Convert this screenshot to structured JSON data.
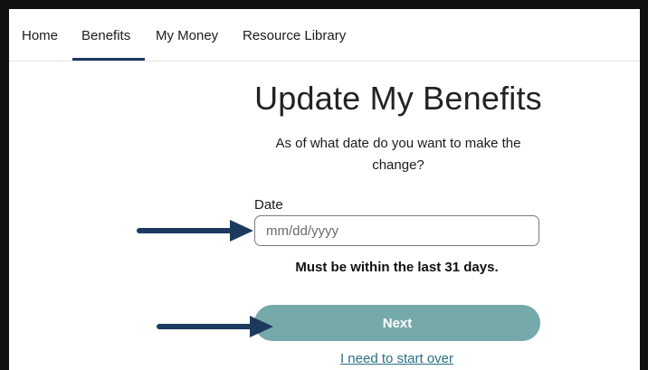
{
  "nav": {
    "items": [
      {
        "label": "Home"
      },
      {
        "label": "Benefits"
      },
      {
        "label": "My Money"
      },
      {
        "label": "Resource Library"
      }
    ],
    "active": "Benefits"
  },
  "main": {
    "title": "Update My Benefits",
    "question": "As of what date do you want to make the change?",
    "date_label": "Date",
    "date_placeholder": "mm/dd/yyyy",
    "date_value": "",
    "hint": "Must be within the last 31 days.",
    "next_label": "Next",
    "start_over_label": "I need to start over"
  },
  "colors": {
    "nav_underline": "#1c3a5e",
    "next_button": "#76a9a9",
    "link": "#2a6f86",
    "annotation_arrow": "#1c3a5e"
  },
  "annotations": [
    {
      "icon": "arrow-right-icon",
      "points_to": "date-input"
    },
    {
      "icon": "arrow-right-icon",
      "points_to": "next-button"
    }
  ]
}
